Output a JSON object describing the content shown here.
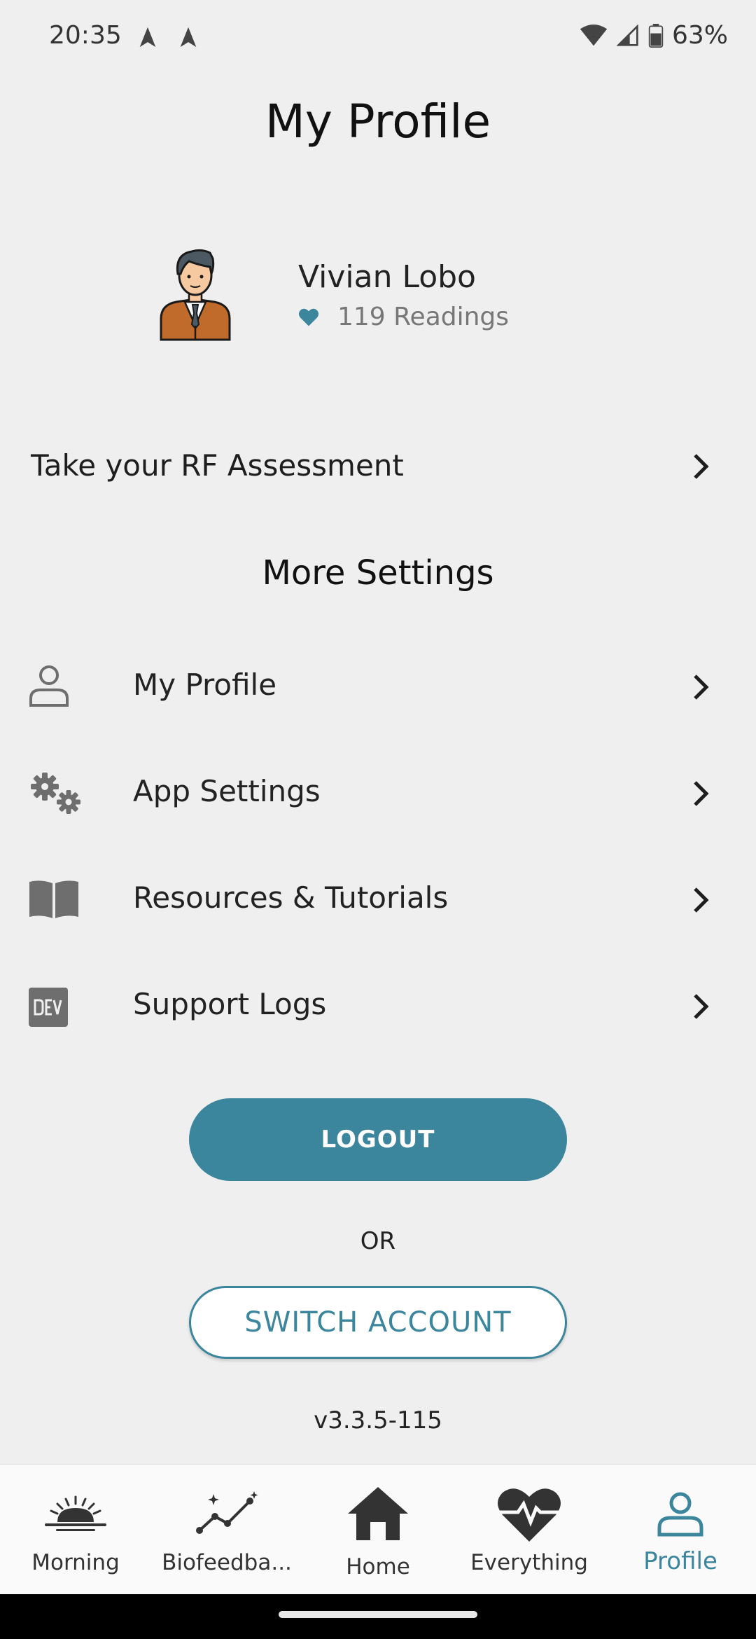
{
  "status_bar": {
    "time": "20:35",
    "battery": "63%"
  },
  "header": {
    "title": "My Profile"
  },
  "profile": {
    "name": "Vivian Lobo",
    "readings": "119 Readings"
  },
  "assessment": {
    "label": "Take your RF Assessment"
  },
  "more_settings": {
    "title": "More Settings",
    "items": [
      {
        "label": "My Profile",
        "icon": "user-outline-icon"
      },
      {
        "label": "App Settings",
        "icon": "gears-icon"
      },
      {
        "label": "Resources & Tutorials",
        "icon": "book-icon"
      },
      {
        "label": "Support Logs",
        "icon": "dev-icon"
      }
    ]
  },
  "actions": {
    "logout": "LOGOUT",
    "or": "OR",
    "switch_account": "SWITCH ACCOUNT",
    "version": "v3.3.5-115"
  },
  "bottom_nav": {
    "items": [
      {
        "label": "Morning",
        "icon": "sunrise-icon"
      },
      {
        "label": "Biofeedba...",
        "icon": "trend-icon"
      },
      {
        "label": "Home",
        "icon": "home-icon"
      },
      {
        "label": "Everything",
        "icon": "heartbeat-icon"
      },
      {
        "label": "Profile",
        "icon": "profile-icon"
      }
    ],
    "active": "Profile"
  },
  "colors": {
    "accent": "#3b859d",
    "background": "#efefef",
    "icon_gray": "#6e6e6e"
  }
}
